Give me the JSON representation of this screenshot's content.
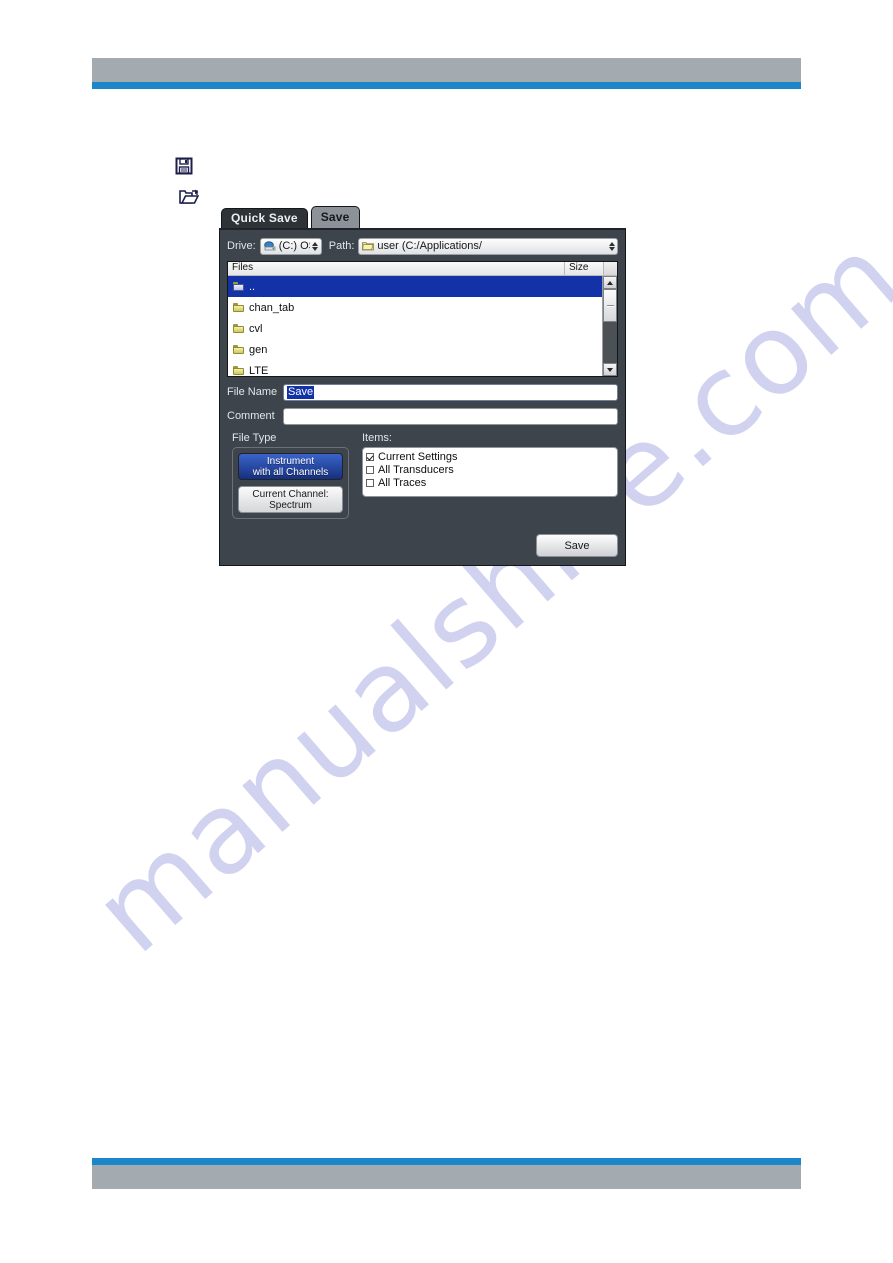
{
  "page": {
    "watermark": "manualshive.com",
    "header_rule_color": "#a4abb0",
    "accent_color": "#1b86c8"
  },
  "margin_icons": [
    {
      "name": "save-floppy-icon",
      "glyph": "floppy-disk"
    },
    {
      "name": "open-folder-icon",
      "glyph": "open-folder"
    }
  ],
  "dialog": {
    "tabs": [
      {
        "label": "Quick Save",
        "active": false
      },
      {
        "label": "Save",
        "active": true
      }
    ],
    "drive": {
      "label": "Drive:",
      "value": "(C:) OS",
      "icon": "drive-icon"
    },
    "path": {
      "label": "Path:",
      "value": "user (C:/Applications/",
      "icon": "folder-icon"
    },
    "file_list": {
      "columns": [
        "Files",
        "Size"
      ],
      "rows": [
        {
          "name": "..",
          "size": "",
          "icon": "folder-up-icon",
          "selected": true
        },
        {
          "name": "chan_tab",
          "size": "",
          "icon": "folder-icon",
          "selected": false
        },
        {
          "name": "cvl",
          "size": "",
          "icon": "folder-icon",
          "selected": false
        },
        {
          "name": "gen",
          "size": "",
          "icon": "folder-icon",
          "selected": false
        },
        {
          "name": "LTE",
          "size": "",
          "icon": "folder-icon",
          "selected": false
        }
      ]
    },
    "file_name": {
      "label": "File Name",
      "value": "Save",
      "selected": true
    },
    "comment": {
      "label": "Comment",
      "value": "",
      "placeholder": ""
    },
    "file_type": {
      "title": "File Type",
      "options": [
        {
          "line1": "Instrument",
          "line2": "with all Channels",
          "selected": true
        },
        {
          "line1": "Current Channel:",
          "line2": "Spectrum",
          "selected": false
        }
      ]
    },
    "items": {
      "title": "Items:",
      "entries": [
        {
          "label": "Current Settings",
          "checked": true
        },
        {
          "label": "All Transducers",
          "checked": false
        },
        {
          "label": "All Traces",
          "checked": false
        }
      ]
    },
    "save_button": "Save"
  }
}
